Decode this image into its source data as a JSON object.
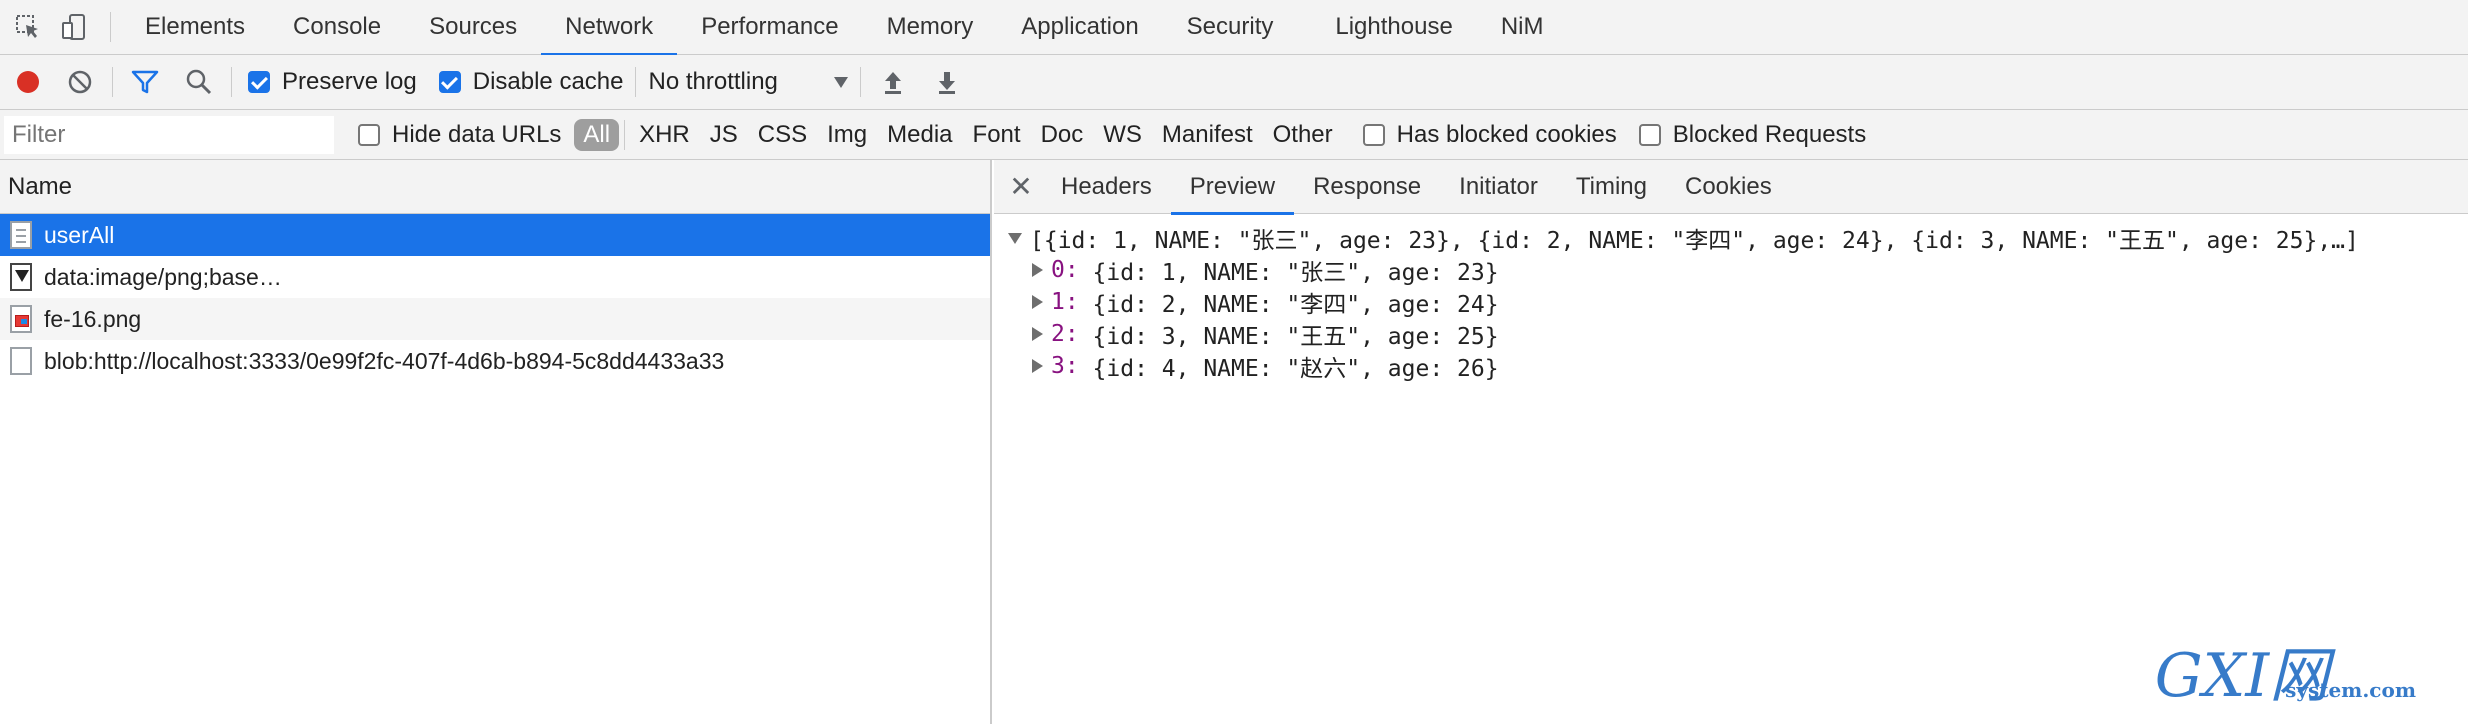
{
  "devtools_tabs": [
    "Elements",
    "Console",
    "Sources",
    "Network",
    "Performance",
    "Memory",
    "Application",
    "Security",
    "Lighthouse",
    "NiM"
  ],
  "active_tab": "Network",
  "toolbar": {
    "preserve_log_label": "Preserve log",
    "preserve_log_checked": true,
    "disable_cache_label": "Disable cache",
    "disable_cache_checked": true,
    "throttling_value": "No throttling"
  },
  "filterbar": {
    "filter_placeholder": "Filter",
    "hide_data_urls_label": "Hide data URLs",
    "types": [
      "All",
      "XHR",
      "JS",
      "CSS",
      "Img",
      "Media",
      "Font",
      "Doc",
      "WS",
      "Manifest",
      "Other"
    ],
    "active_type": "All",
    "has_blocked_cookies_label": "Has blocked cookies",
    "blocked_requests_label": "Blocked Requests"
  },
  "requests": {
    "column_name": "Name",
    "rows": [
      {
        "name": "userAll",
        "icon": "document-icon"
      },
      {
        "name": "data:image/png;base…",
        "icon": "image-icon"
      },
      {
        "name": "fe-16.png",
        "icon": "png-icon"
      },
      {
        "name": "blob:http://localhost:3333/0e99f2fc-407f-4d6b-b894-5c8dd4433a33",
        "icon": "blob-icon"
      }
    ]
  },
  "detail": {
    "tabs": [
      "Headers",
      "Preview",
      "Response",
      "Initiator",
      "Timing",
      "Cookies"
    ],
    "active_tab": "Preview",
    "summary": "[{id: 1, NAME: \"张三\", age: 23}, {id: 2, NAME: \"李四\", age: 24}, {id: 3, NAME: \"王五\", age: 25},…]",
    "items": [
      {
        "key": "0:",
        "value": " {id: 1, NAME: \"张三\", age: 23}"
      },
      {
        "key": "1:",
        "value": " {id: 2, NAME: \"李四\", age: 24}"
      },
      {
        "key": "2:",
        "value": " {id: 3, NAME: \"王五\", age: 25}"
      },
      {
        "key": "3:",
        "value": " {id: 4, NAME: \"赵六\", age: 26}"
      }
    ]
  },
  "watermark": {
    "logo": "GXI网",
    "sub": "system.com"
  },
  "colors": {
    "accent": "#1a73e8",
    "record": "#d93025",
    "json_key": "#881280"
  }
}
